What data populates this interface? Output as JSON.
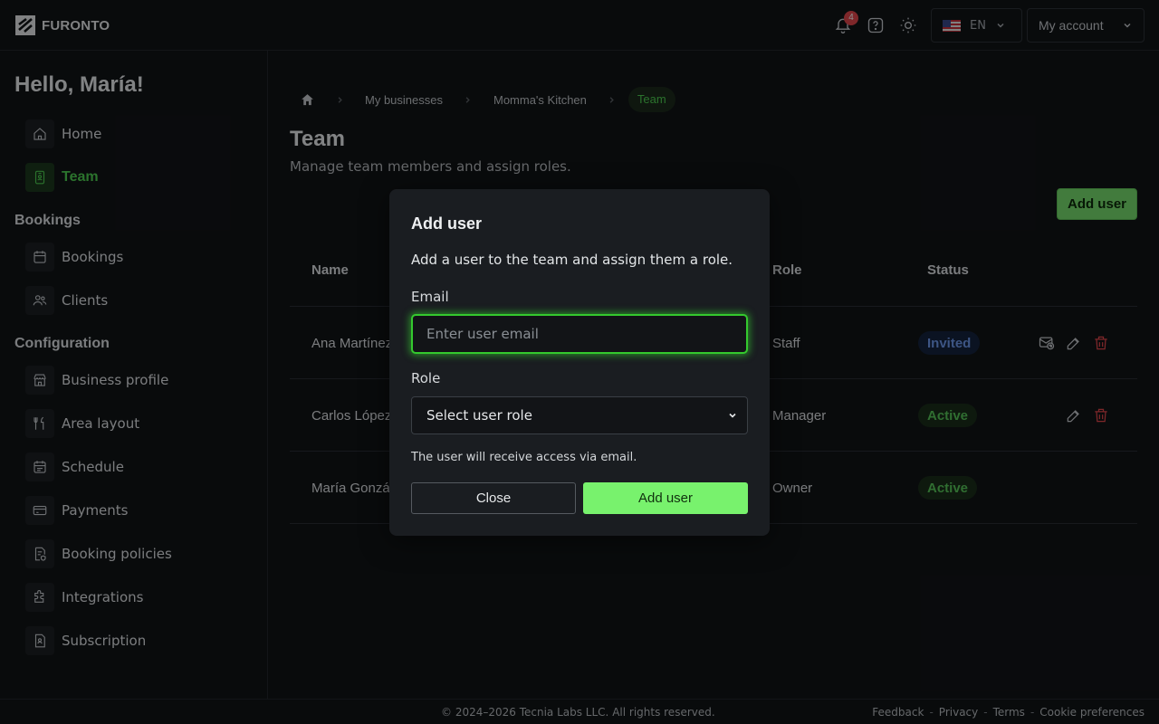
{
  "header": {
    "brand": "FURONTO",
    "notification_count": "4",
    "language": "EN",
    "account_label": "My account"
  },
  "sidebar": {
    "greeting": "Hello, María!",
    "items": {
      "home": "Home",
      "team": "Team",
      "bookings": "Bookings",
      "clients": "Clients",
      "business_profile": "Business profile",
      "area_layout": "Area layout",
      "schedule": "Schedule",
      "payments": "Payments",
      "booking_policies": "Booking policies",
      "integrations": "Integrations",
      "subscription": "Subscription"
    },
    "sections": {
      "bookings": "Bookings",
      "configuration": "Configuration"
    },
    "active_item": "team"
  },
  "breadcrumb": [
    "My businesses",
    "Momma's Kitchen",
    "Team"
  ],
  "page": {
    "title": "Team",
    "subtitle": "Manage team members and assign roles.",
    "add_user_label": "Add user"
  },
  "table": {
    "columns": {
      "name": "Name",
      "role": "Role",
      "status": "Status"
    },
    "rows": [
      {
        "name": "Ana Martínez",
        "role": "Staff",
        "status": "Invited"
      },
      {
        "name": "Carlos López",
        "role": "Manager",
        "status": "Active"
      },
      {
        "name": "María Gonzál",
        "role": "Owner",
        "status": "Active"
      }
    ]
  },
  "modal": {
    "title": "Add user",
    "description": "Add a user to the team and assign them a role.",
    "email_label": "Email",
    "email_placeholder": "Enter user email",
    "email_value": "",
    "role_label": "Role",
    "role_selected": "Select user role",
    "note": "The user will receive access via email.",
    "close_label": "Close",
    "submit_label": "Add user"
  },
  "footer": {
    "copyright": "© 2024–2026 Tecnia Labs LLC. All rights reserved.",
    "links": [
      "Feedback",
      "Privacy",
      "Terms",
      "Cookie preferences"
    ],
    "separator": "-"
  },
  "colors": {
    "accent_green": "#4fd152",
    "invited_blue": "#6f9cf0",
    "danger_red": "#e5484d"
  }
}
